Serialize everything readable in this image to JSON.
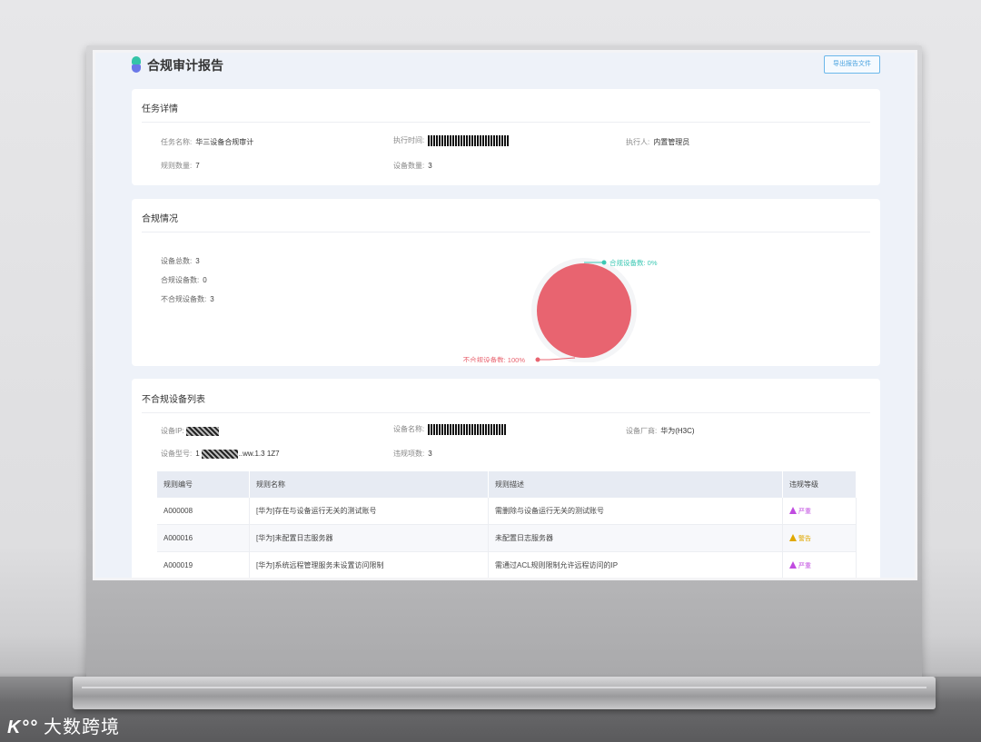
{
  "header": {
    "title": "合规审计报告",
    "export_label": "导出报告文件",
    "colors": {
      "logo_top": "#34c4a8",
      "logo_bottom": "#6a78e8",
      "accent": "#4aa3df"
    }
  },
  "task": {
    "section_title": "任务详情",
    "name_label": "任务名称:",
    "name_value": "华三设备合规审计",
    "time_label": "执行时间:",
    "executor_label": "执行人:",
    "executor_value": "内置管理员",
    "rules_label": "规则数量:",
    "rules_value": "7",
    "devices_label": "设备数量:",
    "devices_value": "3"
  },
  "compliance": {
    "section_title": "合规情况",
    "total_label": "设备总数:",
    "total_value": "3",
    "compliant_label": "合规设备数:",
    "compliant_value": "0",
    "noncompliant_label": "不合规设备数:",
    "noncompliant_value": "3"
  },
  "chart_data": {
    "type": "pie",
    "categories": [
      "合规设备数",
      "不合规设备数"
    ],
    "values": [
      0,
      100
    ],
    "labels": [
      "合规设备数: 0%",
      "不合规设备数: 100%"
    ],
    "colors": [
      "#3cc8b4",
      "#e86470"
    ]
  },
  "noncompliant_list": {
    "section_title": "不合规设备列表",
    "ip_label": "设备IP:",
    "ip_value": "1",
    "device_name_label": "设备名称:",
    "vendor_label": "设备厂商:",
    "vendor_value": "华为(H3C)",
    "model_label": "设备型号:",
    "model_value": "1",
    "model_suffix": "..ww.1.3 1Z7",
    "violations_label": "违规项数:",
    "violations_value": "3",
    "columns": [
      "规则编号",
      "规则名称",
      "规则描述",
      "违规等级"
    ],
    "rows": [
      {
        "id": "A000008",
        "name": "[华为]存在与设备运行无关的测试账号",
        "desc": "需删除与设备运行无关的测试账号",
        "level": "严重",
        "level_color": "#c04be0"
      },
      {
        "id": "A000016",
        "name": "[华为]未配置日志服务器",
        "desc": "未配置日志服务器",
        "level": "警告",
        "level_color": "#e0a800"
      },
      {
        "id": "A000019",
        "name": "[华为]系统远程管理服务未设置访问限制",
        "desc": "需通过ACL规则限制允许远程访问的IP",
        "level": "严重",
        "level_color": "#c04be0"
      }
    ]
  },
  "watermark": {
    "text": "大数跨境",
    "mark": "K°°"
  }
}
